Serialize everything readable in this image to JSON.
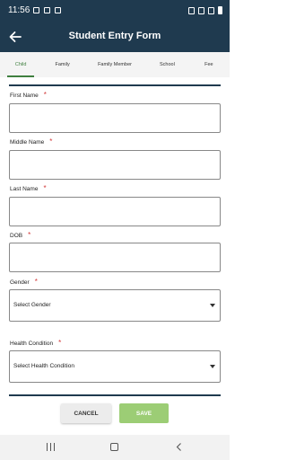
{
  "status_bar": {
    "time": "11:56"
  },
  "app_bar": {
    "title": "Student Entry Form"
  },
  "tabs": [
    {
      "label": "Child",
      "active": true
    },
    {
      "label": "Family",
      "active": false
    },
    {
      "label": "Family Member",
      "active": false
    },
    {
      "label": "School",
      "active": false
    },
    {
      "label": "Fee",
      "active": false
    }
  ],
  "form": {
    "required_mark": "*",
    "first_name": {
      "label": "First Name",
      "value": ""
    },
    "middle_name": {
      "label": "Middle Name",
      "value": ""
    },
    "last_name": {
      "label": "Last Name",
      "value": ""
    },
    "dob": {
      "label": "DOB",
      "value": ""
    },
    "gender": {
      "label": "Gender",
      "selected": "Select Gender"
    },
    "health_condition": {
      "label": "Health Condition",
      "selected": "Select Health Condition"
    }
  },
  "actions": {
    "cancel_label": "CANCEL",
    "save_label": "SAVE"
  },
  "colors": {
    "header": "#1f3a4f",
    "accent_green": "#9ccd75",
    "required": "#d23a3a",
    "active_tab": "#3f7f3f"
  }
}
